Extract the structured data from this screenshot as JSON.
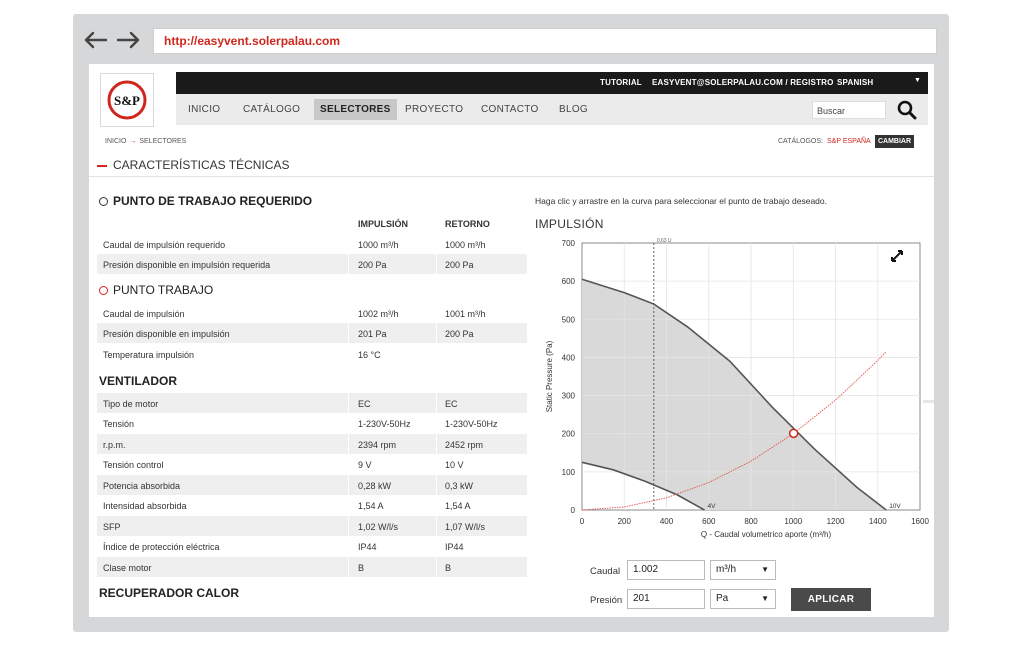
{
  "browser": {
    "url": "http://easyvent.solerpalau.com"
  },
  "header": {
    "logo_text": "S&P",
    "top_links": {
      "tutorial": "TUTORIAL",
      "account": "EASYVENT@SOLERPALAU.COM / REGISTRO",
      "language": "SPANISH"
    },
    "menu": [
      "INICIO",
      "CATÁLOGO",
      "SELECTORES",
      "PROYECTO",
      "CONTACTO",
      "BLOG"
    ],
    "search_placeholder": "Buscar"
  },
  "breadcrumb": {
    "home": "INICIO",
    "current": "SELECTORES"
  },
  "catalog": {
    "label": "CATÁLOGOS:",
    "value": "S&P ESPAÑA",
    "change_button": "CAMBIAR"
  },
  "page_title": "CARACTERÍSTICAS TÉCNICAS",
  "left": {
    "required_title": "PUNTO DE TRABAJO REQUERIDO",
    "columns": [
      "IMPULSIÓN",
      "RETORNO"
    ],
    "required_rows": [
      {
        "label": "Caudal de impulsión requerido",
        "imp": "1000 m³/h",
        "ret": "1000 m³/h"
      },
      {
        "label": "Presión disponible en impulsión requerida",
        "imp": "200 Pa",
        "ret": "200 Pa"
      }
    ],
    "work_title": "PUNTO TRABAJO",
    "work_rows": [
      {
        "label": "Caudal de impulsión",
        "imp": "1002 m³/h",
        "ret": "1001 m³/h"
      },
      {
        "label": "Presión disponible en impulsión",
        "imp": "201 Pa",
        "ret": "200 Pa"
      },
      {
        "label": "Temperatura impulsión",
        "imp": "16 °C",
        "ret": ""
      }
    ],
    "fan_title": "VENTILADOR",
    "fan_rows": [
      {
        "label": "Tipo de motor",
        "imp": "EC",
        "ret": "EC"
      },
      {
        "label": "Tensión",
        "imp": "1-230V-50Hz",
        "ret": "1-230V-50Hz"
      },
      {
        "label": "r.p.m.",
        "imp": "2394 rpm",
        "ret": "2452 rpm"
      },
      {
        "label": "Tensión control",
        "imp": "9 V",
        "ret": "10 V"
      },
      {
        "label": "Potencia absorbida",
        "imp": "0,28 kW",
        "ret": "0,3 kW"
      },
      {
        "label": "Intensidad absorbida",
        "imp": "1,54 A",
        "ret": "1,54 A"
      },
      {
        "label": "SFP",
        "imp": "1,02 W/l/s",
        "ret": "1,07 W/l/s"
      },
      {
        "label": "Índice de protección eléctrica",
        "imp": "IP44",
        "ret": "IP44"
      },
      {
        "label": "Clase motor",
        "imp": "B",
        "ret": "B"
      }
    ],
    "recuperator_title": "RECUPERADOR CALOR"
  },
  "right": {
    "hint": "Haga clic y arrastre en la curva para seleccionar el punto de trabajo deseado.",
    "chart_title": "IMPULSIÓN",
    "form": {
      "flow_label": "Caudal",
      "flow_value": "1.002",
      "flow_unit": "m³/h",
      "pressure_label": "Presión",
      "pressure_value": "201",
      "pressure_unit": "Pa",
      "apply_button": "APLICAR"
    }
  },
  "chart_data": {
    "type": "line",
    "xlabel": "Q - Caudal volumetrico aporte (m³/h)",
    "ylabel": "Static Pressure (Pa)",
    "xlim": [
      0,
      1600
    ],
    "ylim": [
      0,
      700
    ],
    "x_ticks": [
      0,
      200,
      400,
      600,
      800,
      1000,
      1200,
      1400,
      1600
    ],
    "y_ticks": [
      0,
      100,
      200,
      300,
      400,
      500,
      600,
      700
    ],
    "vertical_marker": {
      "x": 340,
      "label": "0.63 U"
    },
    "series": [
      {
        "name": "10V",
        "x": [
          0,
          200,
          340,
          500,
          700,
          900,
          1100,
          1300,
          1440
        ],
        "y": [
          605,
          570,
          540,
          480,
          390,
          270,
          160,
          60,
          0
        ]
      },
      {
        "name": "4V",
        "x": [
          0,
          150,
          300,
          450,
          580
        ],
        "y": [
          125,
          105,
          75,
          40,
          0
        ]
      },
      {
        "name": "",
        "x": [
          0,
          200,
          400,
          600,
          800,
          1002,
          1200,
          1400,
          1440
        ],
        "y": [
          0,
          8,
          32,
          72,
          128,
          201,
          288,
          392,
          415
        ]
      }
    ],
    "operating_point": {
      "x": 1002,
      "y": 201
    },
    "grid": true,
    "colors": {
      "curve": "#555555",
      "system": "#e4554d",
      "area": "#d9d9d9",
      "point": "#d0271d"
    }
  }
}
